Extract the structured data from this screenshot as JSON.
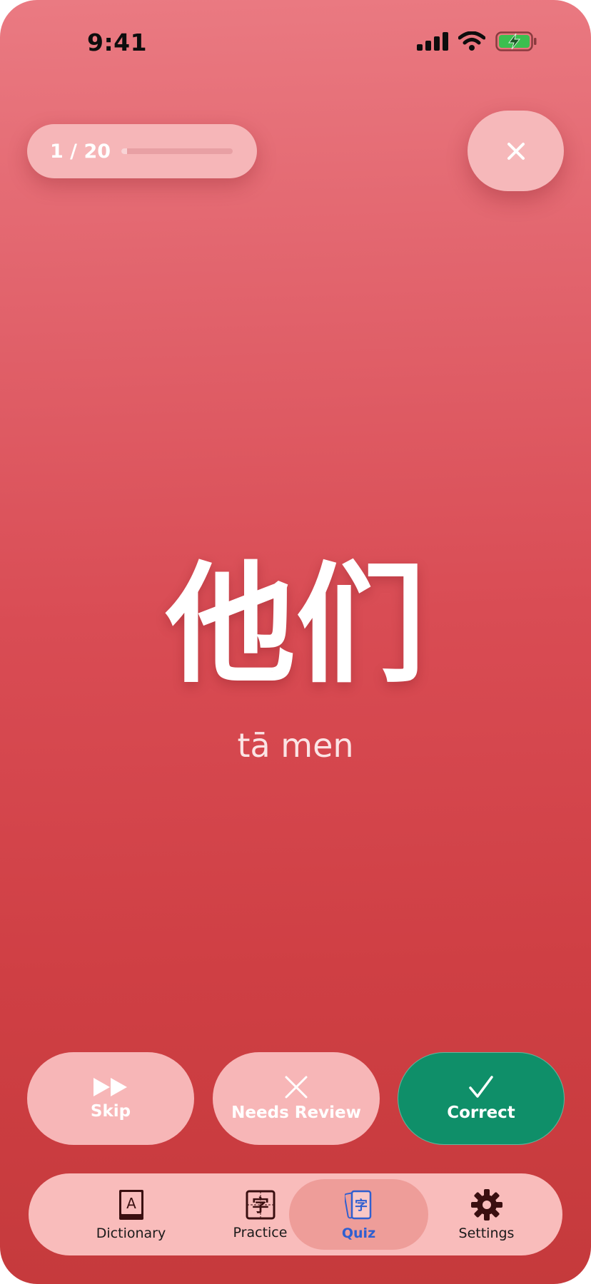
{
  "status_bar": {
    "time": "9:41",
    "battery_color": "#3bbf4f"
  },
  "quiz": {
    "progress_text": "1 / 20",
    "progress_fraction": 0.05,
    "close_icon": "close-icon"
  },
  "card": {
    "hanzi": "他们",
    "pinyin": "tā men"
  },
  "actions": {
    "skip_label": "Skip",
    "review_label": "Needs Review",
    "correct_label": "Correct",
    "correct_color": "#0f8f69"
  },
  "tabs": [
    {
      "label": "Dictionary",
      "icon": "dictionary-book-icon"
    },
    {
      "label": "Practice",
      "icon": "practice-character-icon"
    },
    {
      "label": "Quiz",
      "icon": "quiz-cards-icon",
      "active": true
    },
    {
      "label": "Settings",
      "icon": "gear-icon"
    }
  ],
  "colors": {
    "background_top": "#ea7a82",
    "background_bottom": "#c53a3c",
    "pill": "#f6b6b8",
    "active_tab": "#2f5fd0"
  }
}
